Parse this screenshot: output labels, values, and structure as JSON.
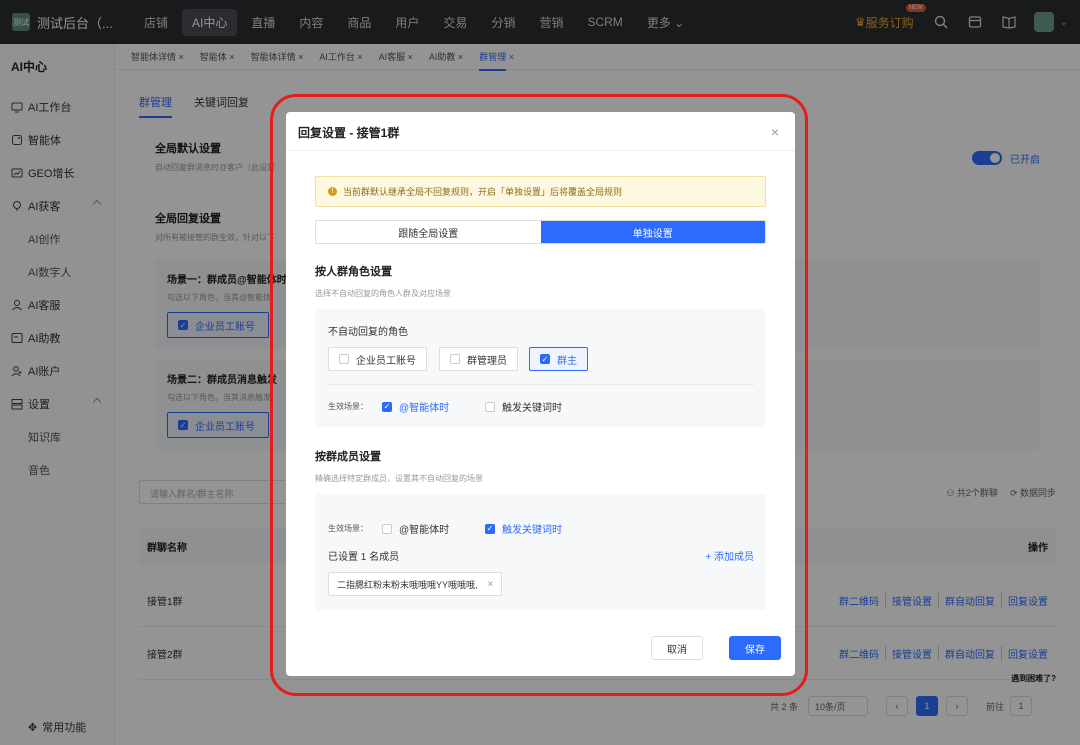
{
  "app": {
    "title": "测试后台（...",
    "logo_text": "测试"
  },
  "top_nav": [
    "店铺",
    "AI中心",
    "直播",
    "内容",
    "商品",
    "用户",
    "交易",
    "分销",
    "营销",
    "SCRM",
    "更多"
  ],
  "top_right": {
    "service": "服务订购",
    "new_badge": "NEW"
  },
  "sidebar": {
    "title": "AI中心",
    "items": [
      {
        "label": "AI工作台",
        "icon": "monitor-icon"
      },
      {
        "label": "智能体",
        "icon": "agent-icon"
      },
      {
        "label": "GEO增长",
        "icon": "growth-icon"
      },
      {
        "label": "AI获客",
        "icon": "location-icon"
      },
      {
        "label": "AI创作",
        "sub": true
      },
      {
        "label": "AI数字人",
        "sub": true
      },
      {
        "label": "AI客服",
        "icon": "user-icon"
      },
      {
        "label": "AI助教",
        "icon": "teach-icon"
      },
      {
        "label": "AI账户",
        "icon": "account-icon"
      },
      {
        "label": "设置",
        "icon": "settings-icon"
      },
      {
        "label": "知识库",
        "sub": true
      },
      {
        "label": "音色",
        "sub": true
      }
    ],
    "bottom": "常用功能"
  },
  "subnav": [
    "智能体详情",
    "智能体",
    "智能体详情",
    "AI工作台",
    "AI客服",
    "AI助教",
    "群管理"
  ],
  "main": {
    "tabs": [
      "群管理",
      "关键词回复"
    ],
    "global_default": {
      "title": "全局默认设置",
      "desc": "自动回复群消息时@客户（此设置"
    },
    "toggle_label": "已开启",
    "global_reply": {
      "title": "全局回复设置",
      "desc": "对所有被接管的群生效，针对以下"
    },
    "scene1": {
      "title": "场景一：群成员@智能体时",
      "desc": "勾选以下角色，当其@智能体",
      "btn": "企业员工账号"
    },
    "scene2": {
      "title": "场景二：群成员消息触发",
      "desc": "勾选以下角色，当其消息触发",
      "btn": "企业员工账号"
    },
    "search_placeholder": "请输入群名/群主名称",
    "tools": {
      "count": "共2个群聊",
      "sync": "数据同步"
    },
    "table_head": {
      "name": "群聊名称",
      "ops": "操作"
    },
    "rows": [
      {
        "name": "接管1群"
      },
      {
        "name": "接管2群"
      }
    ],
    "row_actions": [
      "群二维码",
      "接管设置",
      "群自动回复",
      "回复设置"
    ],
    "pager": {
      "total": "共 2 条",
      "size": "10条/页",
      "page": "1",
      "goto": "前往",
      "goto_val": "1"
    },
    "help": "遇到困难了?"
  },
  "modal": {
    "title": "回复设置 - 接管1群",
    "notice": "当前群默认继承全局不回复规则，开启「单独设置」后将覆盖全局规则",
    "seg": [
      "跟随全局设置",
      "单独设置"
    ],
    "role_section": {
      "title": "按人群角色设置",
      "desc": "选择不自动回复的角色人群及对应场景",
      "label": "不自动回复的角色",
      "roles": [
        "企业员工账号",
        "群管理员",
        "群主"
      ],
      "scene_label": "生效场景：",
      "scenes": [
        "@智能体时",
        "触发关键词时"
      ]
    },
    "member_section": {
      "title": "按群成员设置",
      "desc": "精确选择特定群成员，设置其不自动回复的场景",
      "scene_label": "生效场景：",
      "scenes": [
        "@智能体时",
        "触发关键词时"
      ],
      "count_text": "已设置 1 名成员",
      "add": "+ 添加成员",
      "member": "二指腮红粉末粉末哦哦哦YY哦哦哦,"
    },
    "cancel": "取消",
    "save": "保存"
  }
}
